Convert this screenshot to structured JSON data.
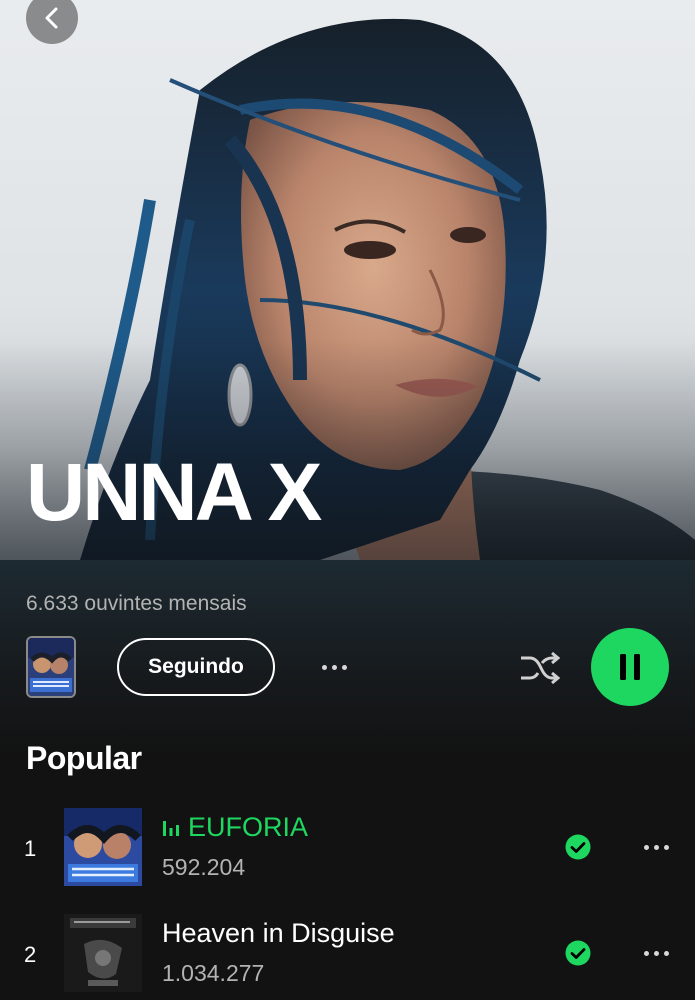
{
  "artist": {
    "name": "UNNA X",
    "monthly_listeners": "6.633 ouvintes mensais"
  },
  "actions": {
    "follow_label": "Seguindo"
  },
  "popular": {
    "title": "Popular",
    "tracks": [
      {
        "number": "1",
        "title": "EUFORIA",
        "plays": "592.204",
        "playing": true,
        "saved": true
      },
      {
        "number": "2",
        "title": "Heaven in Disguise",
        "plays": "1.034.277",
        "playing": false,
        "saved": true
      }
    ]
  },
  "colors": {
    "accent": "#1ed760",
    "background": "#121212",
    "secondary_text": "#b3b3b3"
  },
  "icons": {
    "back": "chevron-left-icon",
    "more": "more-dots-icon",
    "shuffle": "shuffle-icon",
    "play_state": "pause-icon",
    "now_playing": "equalizer-icon",
    "saved": "check-circle-icon"
  }
}
